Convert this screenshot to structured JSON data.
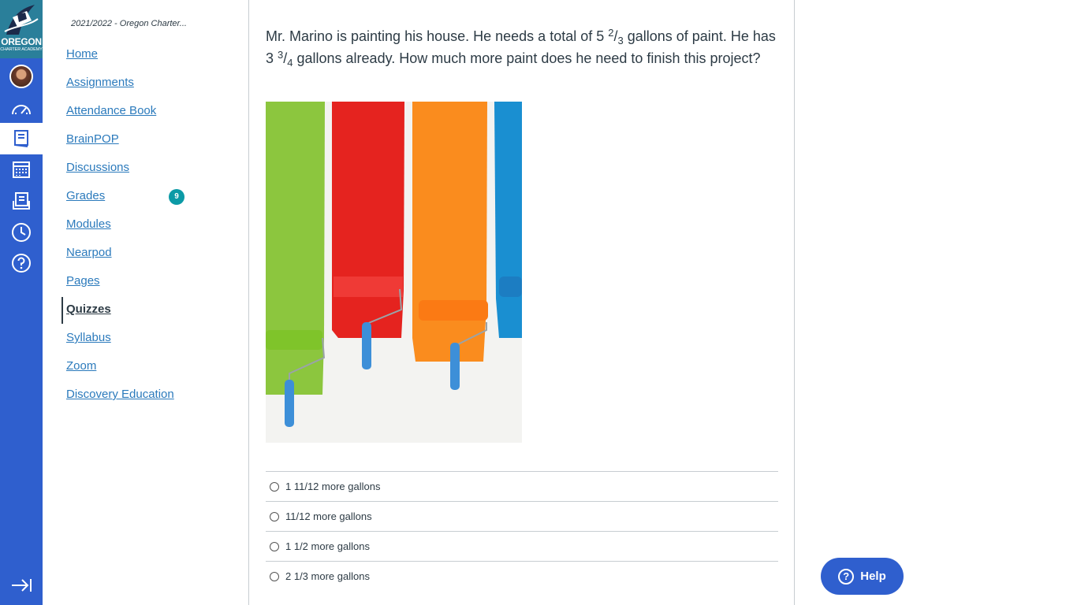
{
  "global_nav": {
    "logo": {
      "text": "OREGON",
      "subtext": "CHARTER ACADEMY"
    },
    "items": [
      {
        "name": "account",
        "icon": "avatar"
      },
      {
        "name": "dashboard",
        "icon": "dashboard-icon"
      },
      {
        "name": "courses",
        "icon": "courses-icon",
        "active": true
      },
      {
        "name": "calendar",
        "icon": "calendar-icon"
      },
      {
        "name": "inbox",
        "icon": "inbox-icon"
      },
      {
        "name": "history",
        "icon": "clock-icon"
      },
      {
        "name": "help",
        "icon": "help-icon"
      }
    ],
    "collapse_icon": "collapse-icon"
  },
  "course_nav": {
    "term": "2021/2022 - Oregon Charter...",
    "links": [
      {
        "label": "Home"
      },
      {
        "label": "Assignments"
      },
      {
        "label": "Attendance Book"
      },
      {
        "label": "BrainPOP"
      },
      {
        "label": "Discussions"
      },
      {
        "label": "Grades",
        "badge": "9"
      },
      {
        "label": "Modules"
      },
      {
        "label": "Nearpod"
      },
      {
        "label": "Pages"
      },
      {
        "label": "Quizzes",
        "active": true
      },
      {
        "label": "Syllabus"
      },
      {
        "label": "Zoom"
      },
      {
        "label": "Discovery Education"
      }
    ]
  },
  "question": {
    "part1": "Mr. Marino is painting his house. He needs a total of 5 ",
    "frac1_num": "2",
    "frac1_slash": "/",
    "frac1_den": "3",
    "part2": " gallons of paint. He has 3 ",
    "frac2_num": "3",
    "frac2_slash": "/",
    "frac2_den": "4",
    "part3": " gallons already. How much more paint does he need to finish this project?"
  },
  "answers": [
    {
      "label": "1 11/12 more gallons"
    },
    {
      "label": "11/12 more gallons"
    },
    {
      "label": "1 1/2 more gallons"
    },
    {
      "label": "2 1/3 more gallons"
    }
  ],
  "help_button": {
    "label": "Help",
    "icon": "?"
  },
  "colors": {
    "nav_blue": "#2f5fce",
    "link_blue": "#2b7abc",
    "badge_teal": "#0b9aa6",
    "text": "#2d3b45"
  }
}
